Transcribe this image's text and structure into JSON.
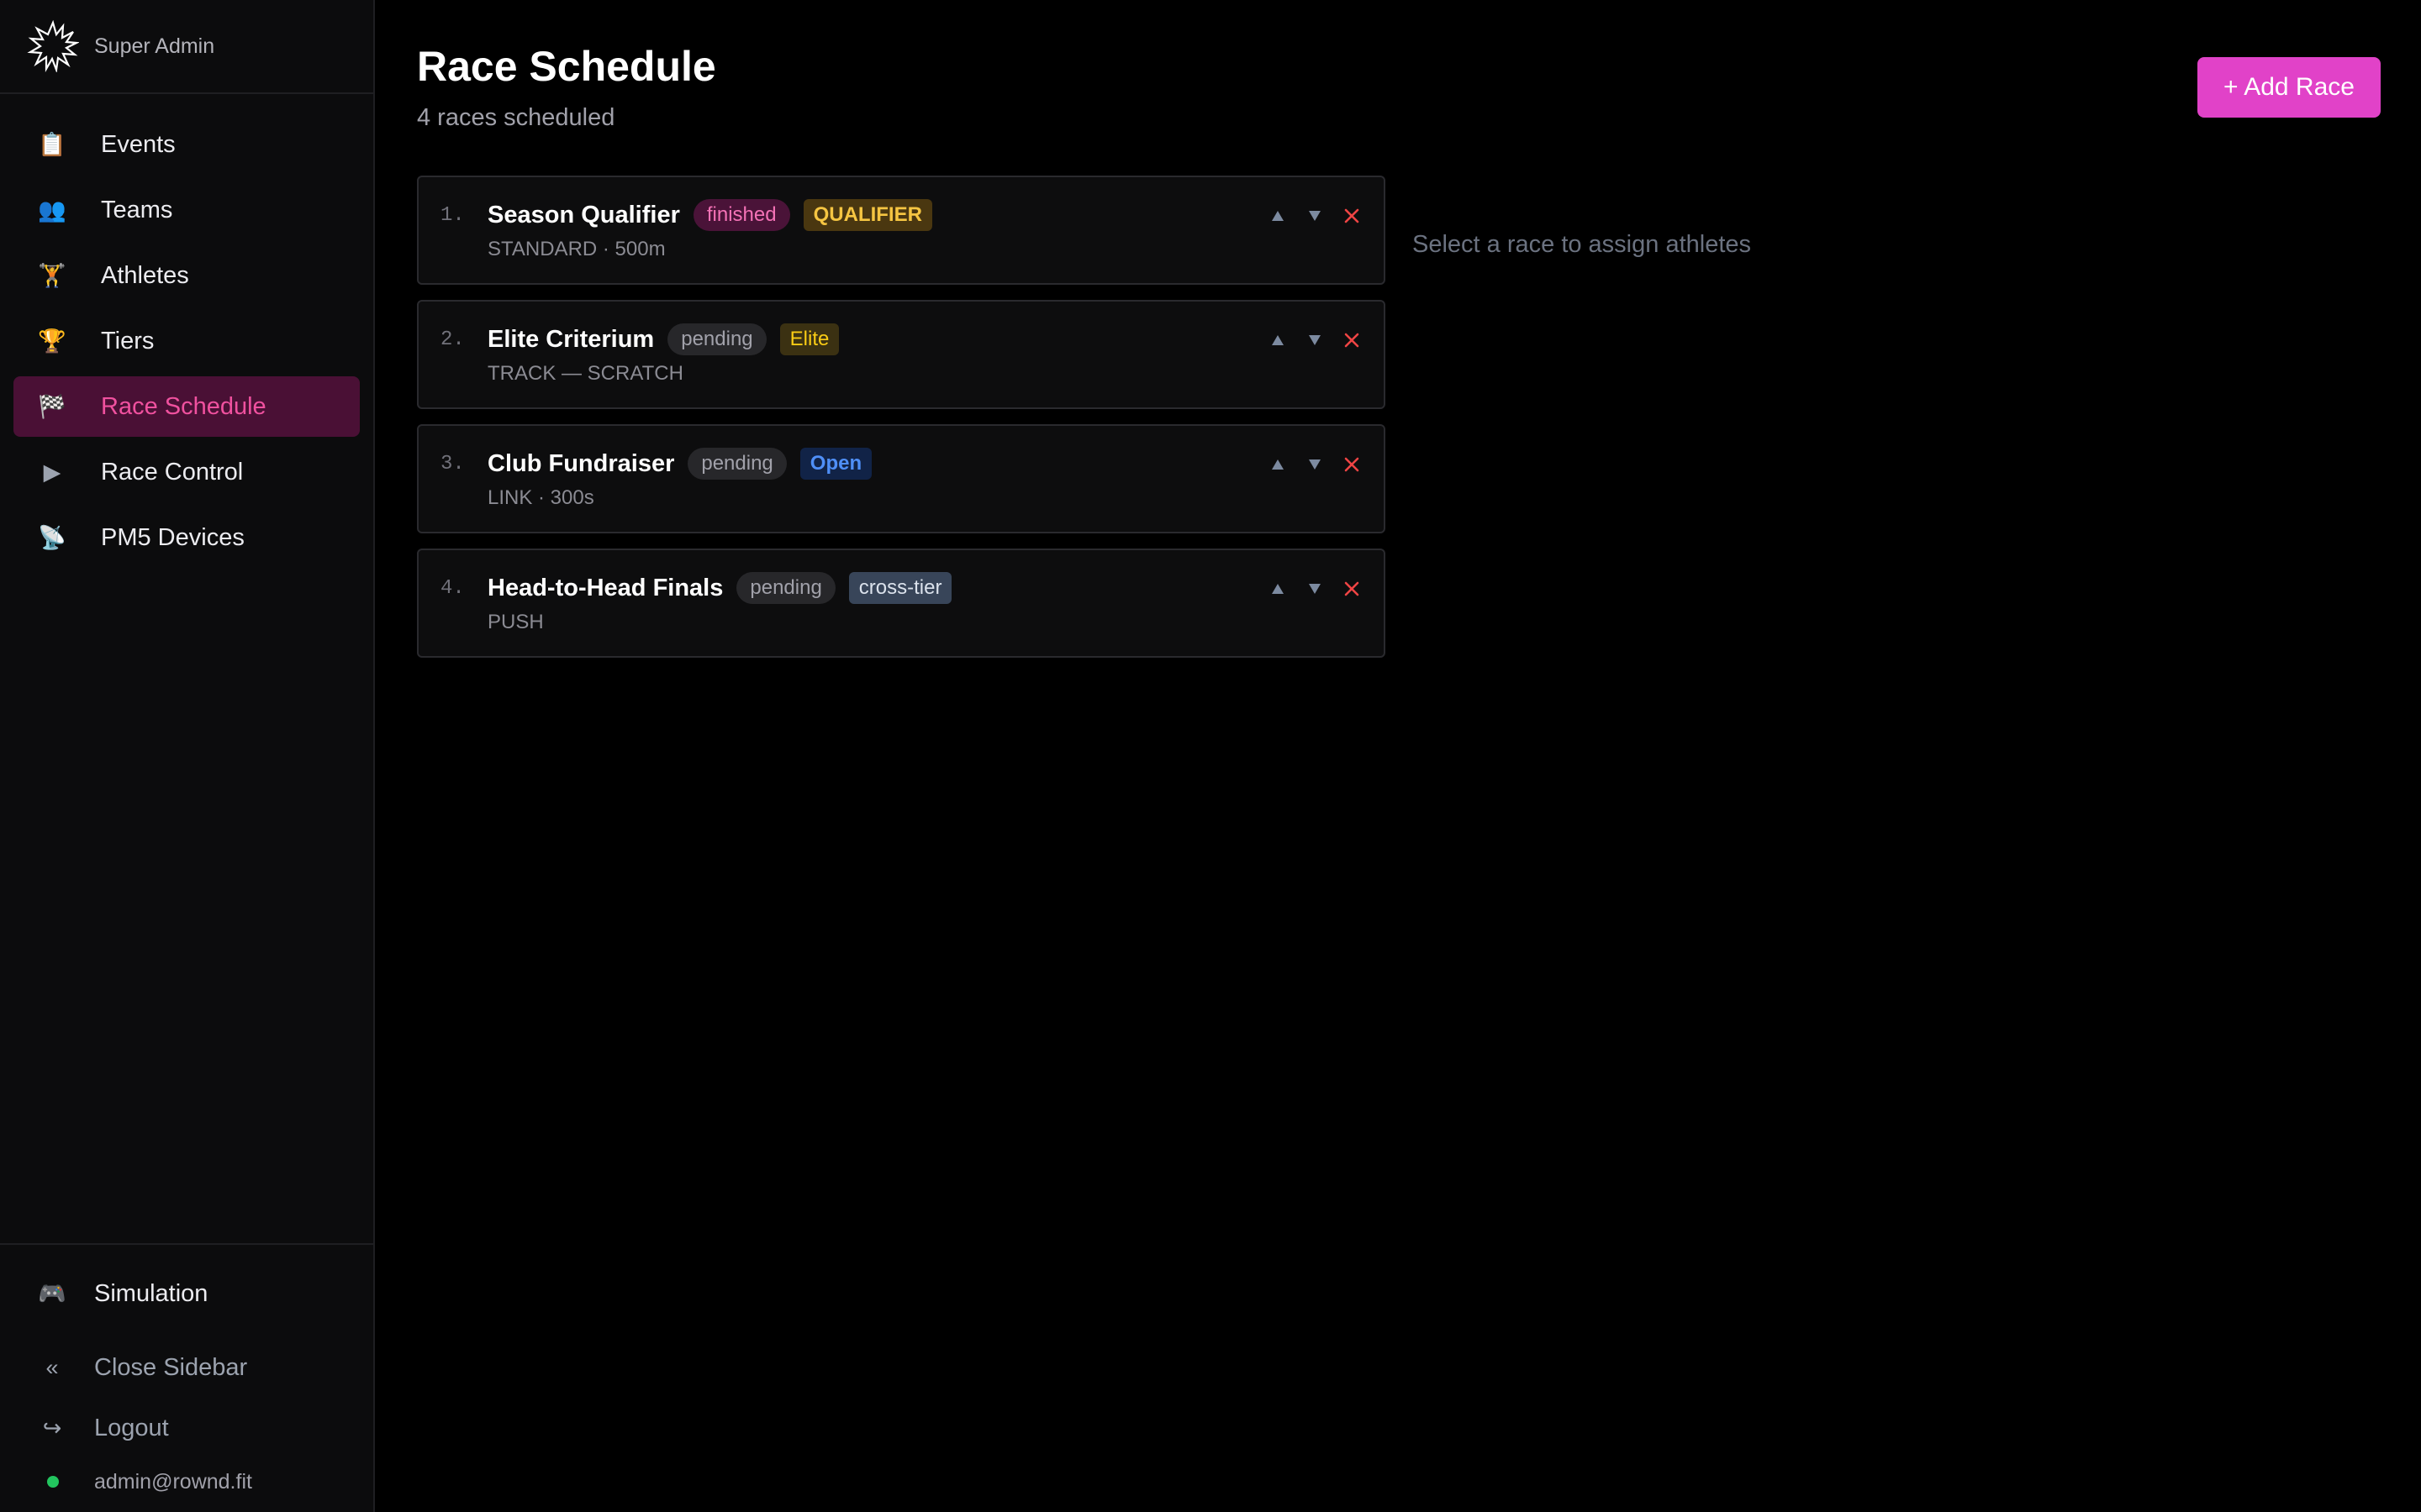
{
  "brand": {
    "name": "Super Admin",
    "logo_icon": "starburst-logo-icon"
  },
  "nav": [
    {
      "key": "events",
      "label": "Events",
      "icon": "clipboard-icon",
      "glyph": "📋",
      "active": false
    },
    {
      "key": "teams",
      "label": "Teams",
      "icon": "people-icon",
      "glyph": "👥",
      "active": false
    },
    {
      "key": "athletes",
      "label": "Athletes",
      "icon": "weightlifter-icon",
      "glyph": "🏋",
      "active": false
    },
    {
      "key": "tiers",
      "label": "Tiers",
      "icon": "trophy-icon",
      "glyph": "🏆",
      "active": false
    },
    {
      "key": "race-schedule",
      "label": "Race Schedule",
      "icon": "checkered-flag-icon",
      "glyph": "🏁",
      "active": true
    },
    {
      "key": "race-control",
      "label": "Race Control",
      "icon": "play-button-icon",
      "glyph": "▶",
      "active": false
    },
    {
      "key": "pm5-devices",
      "label": "PM5 Devices",
      "icon": "satellite-antenna-icon",
      "glyph": "📡",
      "active": false
    }
  ],
  "bottom": {
    "simulation": {
      "label": "Simulation",
      "glyph": "🎮"
    },
    "close_sidebar": {
      "label": "Close Sidebar",
      "glyph": "«"
    },
    "logout": {
      "label": "Logout",
      "glyph": "↪"
    },
    "user_email": "admin@rownd.fit"
  },
  "header": {
    "title": "Race Schedule",
    "subtitle": "4 races scheduled",
    "add_button": "+ Add Race"
  },
  "races": [
    {
      "num": "1.",
      "name": "Season Qualifier",
      "status": "finished",
      "tag": "QUALIFIER",
      "tag_style": "qualifier",
      "meta": "STANDARD · 500m"
    },
    {
      "num": "2.",
      "name": "Elite Criterium",
      "status": "pending",
      "tag": "Elite",
      "tag_style": "elite",
      "meta": "TRACK — SCRATCH"
    },
    {
      "num": "3.",
      "name": "Club Fundraiser",
      "status": "pending",
      "tag": "Open",
      "tag_style": "open",
      "meta": "LINK · 300s"
    },
    {
      "num": "4.",
      "name": "Head-to-Head Finals",
      "status": "pending",
      "tag": "cross-tier",
      "tag_style": "cross",
      "meta": "PUSH"
    }
  ],
  "assign_placeholder": "Select a race to assign athletes",
  "colors": {
    "accent": "#e142c8",
    "active_nav_bg": "#4a1035",
    "active_nav_text": "#f0519f",
    "delete_red": "#ef4444",
    "online_green": "#22c55e"
  }
}
